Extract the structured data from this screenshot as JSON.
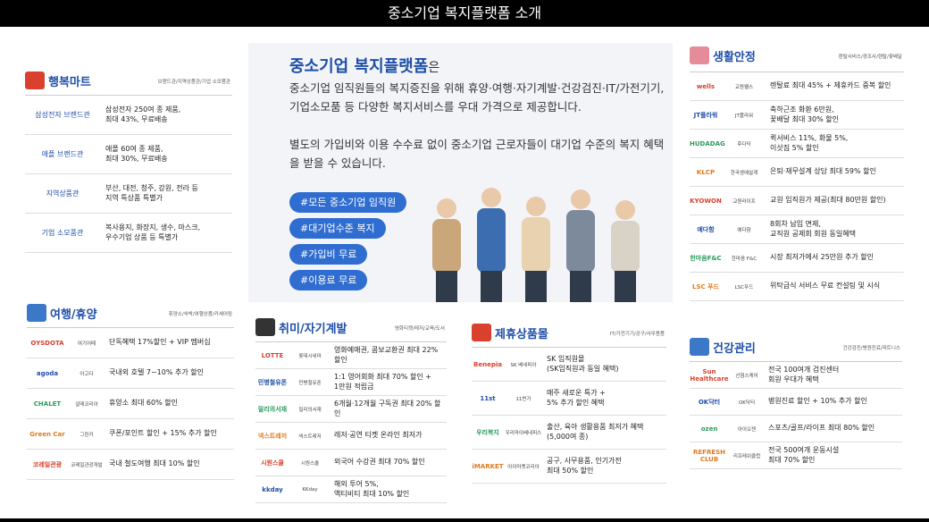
{
  "title": "중소기업 복지플랫폼 소개",
  "happy": {
    "title": "행복마트",
    "sub": "브랜드관/지역상품관/기업 소모품관",
    "rows": [
      {
        "label": "삼성전자 브랜드관",
        "desc": "삼성전자 250여 종 제품,\n최대 43%, 무료배송"
      },
      {
        "label": "애플 브랜드관",
        "desc": "애플 60여 종 제품,\n최대 30%, 무료배송"
      },
      {
        "label": "지역상품관",
        "desc": "부산, 대전, 청주, 강원, 전라 등\n지역 특상품 특별가"
      },
      {
        "label": "기업 소모품관",
        "desc": "복사용지, 화장지, 생수, 마스크,\n우수기업 상품 등 특별가"
      }
    ]
  },
  "hero": {
    "title": "중소기업 복지플랫폼",
    "title_suffix": "은",
    "p1": "중소기업 임직원들의 복지증진을 위해 휴양·여행·자기계발·건강검진·IT/가전기기,기업소모품 등 다양한 복지서비스를 우대 가격으로 제공합니다.",
    "p2": "별도의 가입비와 이용 수수료 없이 중소기업 근로자들이 대기업 수준의 복지 혜택을 받을 수 있습니다.",
    "tags": [
      "#모든 중소기업 임직원",
      "#대기업수준 복지",
      "#가입비 무료",
      "#이용료 무료"
    ]
  },
  "travel": {
    "title": "여행/휴양",
    "sub": "휴양소/숙박/여행상품/카셰어링",
    "rows": [
      {
        "logo": "OYSDOTA",
        "name": "여기어때",
        "desc": "단독혜택 17%할인 + VIP 멤버십"
      },
      {
        "logo": "agoda",
        "name": "아고다",
        "desc": "국내외 호텔 7~10% 추가 할인"
      },
      {
        "logo": "CHALET",
        "name": "샬레코리아",
        "desc": "휴양소 최대 60% 할인"
      },
      {
        "logo": "Green Car",
        "name": "그린카",
        "desc": "쿠폰/포인트 할인 + 15% 추가 할인"
      },
      {
        "logo": "코레일관광",
        "name": "코레일관광개발",
        "desc": "국내 철도여행 최대 10% 할인"
      }
    ]
  },
  "hobby": {
    "title": "취미/자기계발",
    "sub": "영화티켓/레저/교육/도서",
    "rows": [
      {
        "logo": "LOTTE",
        "name": "롯데시네마",
        "desc": "영화예매권, 콤보교환권 최대 22% 할인"
      },
      {
        "logo": "민병철유폰",
        "name": "민병철유폰",
        "desc": "1:1 영어회화 최대 70% 할인 +\n1만원 적립금"
      },
      {
        "logo": "밀리의서재",
        "name": "밀리의서재",
        "desc": "6개월·12개월 구독권 최대 20% 할인"
      },
      {
        "logo": "넥스트레저",
        "name": "넥스트레저",
        "desc": "레저·공연 티켓 온라인 최저가"
      },
      {
        "logo": "시원스쿨",
        "name": "시원스쿨",
        "desc": "외국어 수강권 최대 70% 할인"
      },
      {
        "logo": "kkday",
        "name": "KKday",
        "desc": "해외 투어 5%,\n액티비티 최대 10% 할인"
      }
    ]
  },
  "partner": {
    "title": "제휴상품몰",
    "sub": "IT/가전기기/공구/사무용품",
    "rows": [
      {
        "logo": "Benepia",
        "name": "SK 베네피아",
        "desc": "SK 임직원몰\n(SK임직원과 동일 혜택)"
      },
      {
        "logo": "11st",
        "name": "11번가",
        "desc": "매주 새로운 특가 +\n5% 추가 할인 혜택"
      },
      {
        "logo": "우리복지",
        "name": "우리마이베네피스",
        "desc": "출산, 육아 생활용품 최저가 혜택\n(5,000여 종)"
      },
      {
        "logo": "iMARKET",
        "name": "아이마켓코리아",
        "desc": "공구, 사무용품, 인기가전\n최대 50% 할인"
      }
    ]
  },
  "life": {
    "title": "생활안정",
    "sub": "렌탈서비스/경조사/렌탈/꽃배달",
    "rows": [
      {
        "logo": "wells",
        "name": "교원웰스",
        "desc": "렌탈료 최대 45% + 제휴카드 중복 할인"
      },
      {
        "logo": "JT플라워",
        "name": "JT플라워",
        "desc": "축하근조 화환 6만원,\n꽃배달 최대 30% 할인"
      },
      {
        "logo": "HUDADAG",
        "name": "후다닥",
        "desc": "퀵서비스 11%, 화물 5%,\n이삿짐 5% 할인"
      },
      {
        "logo": "KLCP",
        "name": "한국생애설계",
        "desc": "은퇴·재무설계 상담 최대 59% 할인"
      },
      {
        "logo": "KYOWON",
        "name": "교원라이프",
        "desc": "교원 임직원가 제공(최대 80만원 할인)"
      },
      {
        "logo": "예다함",
        "name": "예다함",
        "desc": "8회차 납입 면제,\n교직원 공제회 회원 동일혜택"
      },
      {
        "logo": "한마음F&C",
        "name": "한마음 F&C",
        "desc": "시장 최저가에서 25만원 추가 할인"
      },
      {
        "logo": "LSC 푸드",
        "name": "LSC푸드",
        "desc": "위탁급식 서비스 무료 컨설팅 및 시식"
      }
    ]
  },
  "health": {
    "title": "건강관리",
    "sub": "건강검진/병원진료/피트니스",
    "rows": [
      {
        "logo": "Sun Healthcare",
        "name": "선형스케어",
        "desc": "전국 100여개 검진센터\n회원 우대가 혜택"
      },
      {
        "logo": "OK닥터",
        "name": "OK닥터",
        "desc": "병원진료 할인 + 10% 추가 할인"
      },
      {
        "logo": "ozen",
        "name": "아이오젠",
        "desc": "스포츠/골프/라이프 최대 80% 할인"
      },
      {
        "logo": "REFRESH CLUB",
        "name": "리프레쉬클럽",
        "desc": "전국 500여개 운동시설\n최대 70% 할인"
      }
    ]
  },
  "colors": {
    "accent": "#1f4ea8",
    "tag": "#2f6dd0"
  }
}
